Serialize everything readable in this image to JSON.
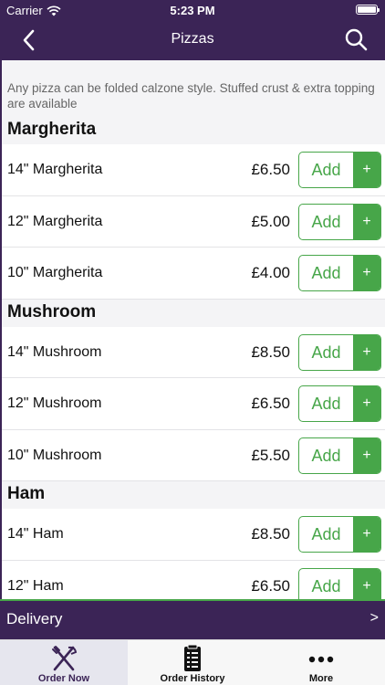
{
  "status_bar": {
    "carrier": "Carrier",
    "time": "5:23 PM"
  },
  "nav": {
    "title": "Pizzas",
    "back_icon": "chevron-left-icon",
    "search_icon": "search-icon"
  },
  "info_note": "Any pizza can be folded calzone style. Stuffed crust & extra topping are available",
  "sections": [
    {
      "title": "Margherita",
      "items": [
        {
          "name": "14\" Margherita",
          "price": "£6.50",
          "add_label": "Add",
          "plus_label": "+"
        },
        {
          "name": "12\" Margherita",
          "price": "£5.00",
          "add_label": "Add",
          "plus_label": "+"
        },
        {
          "name": "10\" Margherita",
          "price": "£4.00",
          "add_label": "Add",
          "plus_label": "+"
        }
      ]
    },
    {
      "title": "Mushroom",
      "items": [
        {
          "name": "14\" Mushroom",
          "price": "£8.50",
          "add_label": "Add",
          "plus_label": "+"
        },
        {
          "name": "12\" Mushroom",
          "price": "£6.50",
          "add_label": "Add",
          "plus_label": "+"
        },
        {
          "name": "10\" Mushroom",
          "price": "£5.50",
          "add_label": "Add",
          "plus_label": "+"
        }
      ]
    },
    {
      "title": "Ham",
      "items": [
        {
          "name": "14\" Ham",
          "price": "£8.50",
          "add_label": "Add",
          "plus_label": "+"
        },
        {
          "name": "12\" Ham",
          "price": "£6.50",
          "add_label": "Add",
          "plus_label": "+"
        }
      ]
    }
  ],
  "delivery_bar": {
    "label": "Delivery",
    "chevron": ">"
  },
  "tabs": [
    {
      "label": "Order Now",
      "icon": "fork-knife-icon",
      "active": true
    },
    {
      "label": "Order History",
      "icon": "receipt-icon",
      "active": false
    },
    {
      "label": "More",
      "icon": "more-dots-icon",
      "active": false
    }
  ],
  "colors": {
    "header": "#3b2456",
    "accent_green": "#47a649",
    "section_bg": "#f4f4f6"
  }
}
